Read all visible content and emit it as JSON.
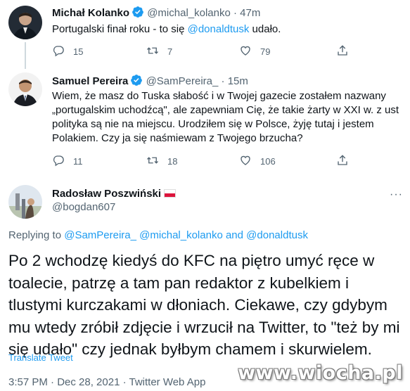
{
  "tweets": [
    {
      "name": "Michał Kolanko",
      "handle": "@michal_kolanko",
      "dot": "·",
      "time": "47m",
      "text_before": "Portugalski finał roku - to się ",
      "mention": "@donaldtusk",
      "text_after": " udało.",
      "replies": "15",
      "retweets": "7",
      "likes": "79"
    },
    {
      "name": "Samuel Pereira",
      "handle": "@SamPereira_",
      "dot": "·",
      "time": "15m",
      "text": "Wiem, że masz do Tuska słabość i w Twojej gazecie zostałem nazwany „portugalskim uchodźcą\", ale zapewniam Cię, że takie żarty w XXI w. z ust polityka są nie na miejscu. Urodziłem się w Polsce, żyję tutaj i jestem Polakiem. Czy ja się naśmiewam z Twojego brzucha?",
      "replies": "11",
      "retweets": "18",
      "likes": "106"
    }
  ],
  "main_tweet": {
    "name": "Radosław Poszwiński",
    "flag": "poland-flag",
    "handle": "@bogdan607",
    "more": "···",
    "replying_prefix": "Replying to ",
    "replying_mention1": "@SamPereira_",
    "replying_mention2": "@michal_kolanko",
    "replying_and": " and ",
    "replying_mention3": "@donaldtusk",
    "text": "Po 2 wchodzę kiedyś do KFC na piętro umyć ręce w toalecie, patrzę a tam pan redaktor z kubelkiem i tlustymi kurczakami w dłoniach. Ciekawe, czy gdybym mu wtedy zróbił zdjęcie i wrzucił na Twitter, to \"też by mi się udało\" czy jednak byłbym chamem i skurwielem.",
    "translate": "Translate Tweet",
    "timestamp": "3:57 PM · Dec 28, 2021 · Twitter Web App"
  },
  "watermark": "www.wiocha.pl",
  "colors": {
    "accent": "#1d9bf0",
    "secondary_text": "#536471",
    "primary_text": "#0f1419"
  },
  "icons": [
    "reply-icon",
    "retweet-icon",
    "like-icon",
    "share-icon",
    "verified-icon"
  ]
}
